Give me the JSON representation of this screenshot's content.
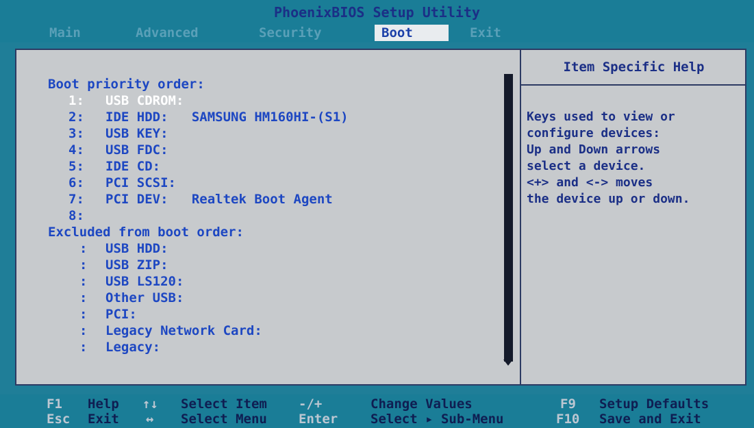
{
  "title": "PhoenixBIOS Setup Utility",
  "menu": [
    "Main",
    "Advanced",
    "Security",
    "Boot",
    "Exit"
  ],
  "active_menu": "Boot",
  "boot": {
    "heading": "Boot priority order:",
    "items": [
      {
        "num": "1:",
        "label": "USB CDROM:"
      },
      {
        "num": "2:",
        "label": "IDE HDD:   SAMSUNG HM160HI-(S1)"
      },
      {
        "num": "3:",
        "label": "USB KEY:"
      },
      {
        "num": "4:",
        "label": "USB FDC:"
      },
      {
        "num": "5:",
        "label": "IDE CD:"
      },
      {
        "num": "6:",
        "label": "PCI SCSI:"
      },
      {
        "num": "7:",
        "label": "PCI DEV:   Realtek Boot Agent"
      },
      {
        "num": "8:",
        "label": ""
      }
    ],
    "excluded_heading": "Excluded from boot order:",
    "excluded": [
      {
        "num": ":",
        "label": "USB HDD:"
      },
      {
        "num": ":",
        "label": "USB ZIP:"
      },
      {
        "num": ":",
        "label": "USB LS120:"
      },
      {
        "num": ":",
        "label": "Other USB:"
      },
      {
        "num": ":",
        "label": "PCI:"
      },
      {
        "num": ":",
        "label": "Legacy Network Card:"
      },
      {
        "num": ":",
        "label": "Legacy:"
      }
    ]
  },
  "help": {
    "title": "Item Specific Help",
    "lines": [
      "Keys used to view or",
      "configure devices:",
      "Up and Down arrows",
      "select a device.",
      "<+> and <-> moves",
      "the device up or down."
    ]
  },
  "footer": {
    "row1": [
      {
        "key": "F1",
        "desc": "Help"
      },
      {
        "key": "↑↓",
        "desc": "Select Item"
      },
      {
        "key": "-/+",
        "desc": "Change Values"
      },
      {
        "key": "F9",
        "desc": "Setup Defaults"
      }
    ],
    "row2": [
      {
        "key": "Esc",
        "desc": "Exit"
      },
      {
        "key": "↔",
        "desc": "Select Menu"
      },
      {
        "key": "Enter",
        "desc": "Select ▸ Sub-Menu"
      },
      {
        "key": "F10",
        "desc": "Save and Exit"
      }
    ]
  },
  "colors": {
    "background": "#1f7e98",
    "panel": "#c7cacd",
    "text_blue": "#1d47c2",
    "highlight": "#ffffff",
    "active_tab": "#e9ecef"
  }
}
